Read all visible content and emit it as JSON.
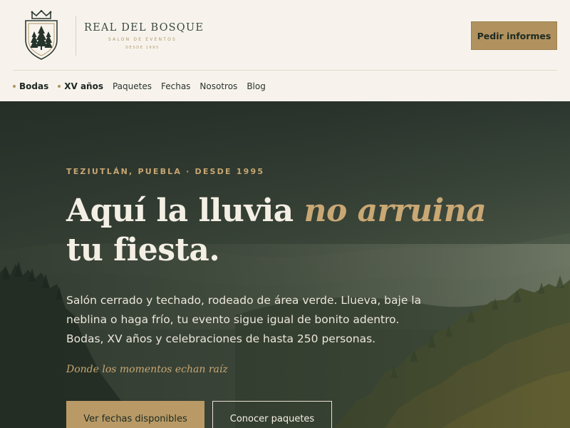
{
  "brand": {
    "name": "REAL DEL BOSQUE",
    "subtitle": "SALON DE EVENTOS",
    "since": "DESDE 1995",
    "crest_icon": "shield-pine-crown-icon"
  },
  "header": {
    "cta_label": "Pedir informes"
  },
  "nav": {
    "items": [
      {
        "label": "Bodas",
        "active": true
      },
      {
        "label": "XV años",
        "active": true
      },
      {
        "label": "Paquetes",
        "active": false
      },
      {
        "label": "Fechas",
        "active": false
      },
      {
        "label": "Nosotros",
        "active": false
      },
      {
        "label": "Blog",
        "active": false
      }
    ]
  },
  "hero": {
    "eyebrow": "TEZIUTLÁN, PUEBLA · DESDE 1995",
    "headline_part1": "Aquí la lluvia ",
    "headline_em": "no arruina",
    "headline_part2": " tu fiesta.",
    "lede": "Salón cerrado y techado, rodeado de área verde. Llueva, baje la neblina o haga frío, tu evento sigue igual de bonito adentro. Bodas, XV años y celebraciones de hasta 250 personas.",
    "tagline": "Donde los momentos echan raíz",
    "primary_cta": "Ver fechas disponibles",
    "secondary_cta": "Conocer paquetes",
    "background_image": "misty-forest-mountains"
  },
  "colors": {
    "accent_gold": "#b1925f",
    "header_bg": "#f7f3ec",
    "hero_text": "#f4efe5",
    "forest_dark": "#2f3a31"
  }
}
